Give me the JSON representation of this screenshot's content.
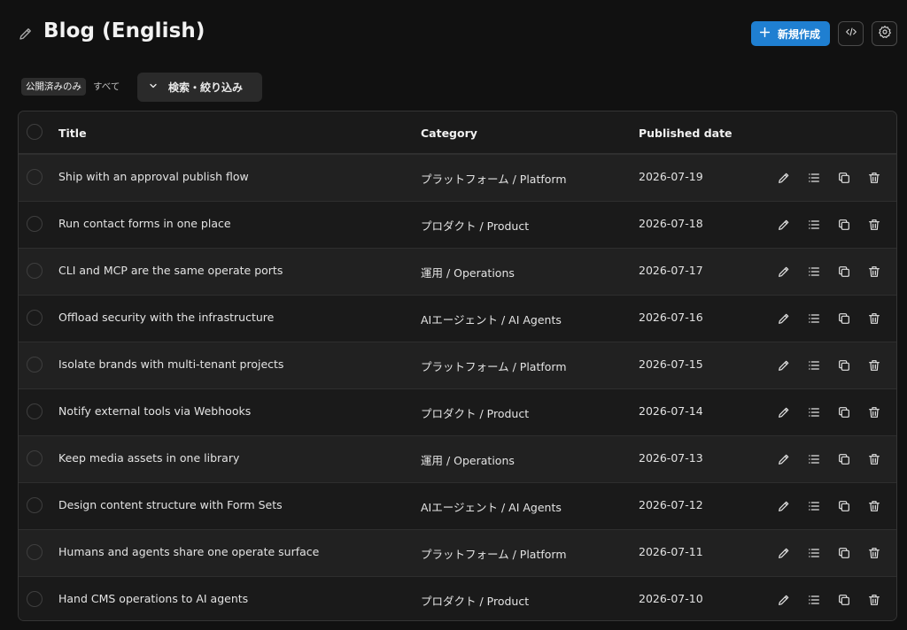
{
  "header": {
    "title": "Blog (English)",
    "new_label": "新規作成",
    "accent_color": "#1f7fd1"
  },
  "filters": {
    "published_only_label": "公開済みのみ",
    "all_label": "すべて",
    "search_label": "検索・絞り込み"
  },
  "table": {
    "columns": {
      "title": "Title",
      "category": "Category",
      "date": "Published date"
    },
    "rows": [
      {
        "title": "Ship with an approval publish flow",
        "category": "プラットフォーム / Platform",
        "date": "2026-07-19"
      },
      {
        "title": "Run contact forms in one place",
        "category": "プロダクト / Product",
        "date": "2026-07-18"
      },
      {
        "title": "CLI and MCP are the same operate ports",
        "category": "運用 / Operations",
        "date": "2026-07-17"
      },
      {
        "title": "Offload security with the infrastructure",
        "category": "AIエージェント / AI Agents",
        "date": "2026-07-16"
      },
      {
        "title": "Isolate brands with multi-tenant projects",
        "category": "プラットフォーム / Platform",
        "date": "2026-07-15"
      },
      {
        "title": "Notify external tools via Webhooks",
        "category": "プロダクト / Product",
        "date": "2026-07-14"
      },
      {
        "title": "Keep media assets in one library",
        "category": "運用 / Operations",
        "date": "2026-07-13"
      },
      {
        "title": "Design content structure with Form Sets",
        "category": "AIエージェント / AI Agents",
        "date": "2026-07-12"
      },
      {
        "title": "Humans and agents share one operate surface",
        "category": "プラットフォーム / Platform",
        "date": "2026-07-11"
      },
      {
        "title": "Hand CMS operations to AI agents",
        "category": "プロダクト / Product",
        "date": "2026-07-10"
      }
    ]
  }
}
